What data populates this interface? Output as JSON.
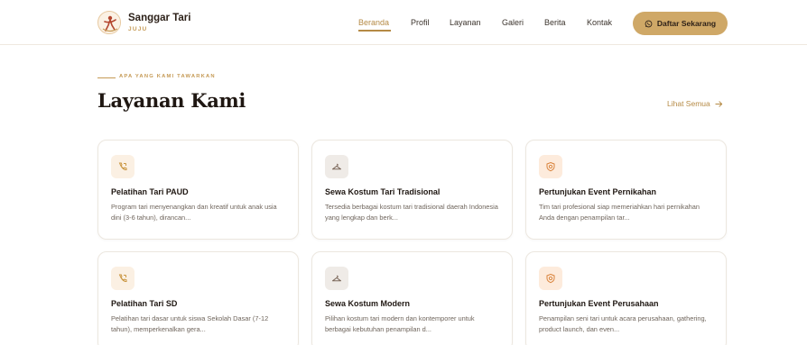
{
  "brand": {
    "name": "Sanggar Tari",
    "sub": "JUJU"
  },
  "nav": {
    "items": [
      {
        "label": "Beranda",
        "active": true
      },
      {
        "label": "Profil",
        "active": false
      },
      {
        "label": "Layanan",
        "active": false
      },
      {
        "label": "Galeri",
        "active": false
      },
      {
        "label": "Berita",
        "active": false
      },
      {
        "label": "Kontak",
        "active": false
      }
    ],
    "cta_label": "Daftar Sekarang",
    "cta_icon": "whatsapp-icon"
  },
  "section": {
    "eyebrow": "APA YANG KAMI TAWARKAN",
    "title": "Layanan Kami",
    "see_all": "Lihat Semua"
  },
  "cards": [
    {
      "icon": "phone-icon",
      "title": "Pelatihan Tari PAUD",
      "desc": "Program tari menyenangkan dan kreatif untuk anak usia dini (3-6 tahun), dirancan..."
    },
    {
      "icon": "hanger-icon",
      "title": "Sewa Kostum Tari Tradisional",
      "desc": "Tersedia berbagai kostum tari tradisional daerah Indonesia yang lengkap dan berk..."
    },
    {
      "icon": "shield-icon",
      "title": "Pertunjukan Event Pernikahan",
      "desc": "Tim tari profesional siap memeriahkan hari pernikahan Anda dengan penampilan tar..."
    },
    {
      "icon": "phone-icon",
      "title": "Pelatihan Tari SD",
      "desc": "Pelatihan tari dasar untuk siswa Sekolah Dasar (7-12 tahun), memperkenalkan gera..."
    },
    {
      "icon": "hanger-icon",
      "title": "Sewa Kostum Modern",
      "desc": "Pilihan kostum tari modern dan kontemporer untuk berbagai kebutuhan penampilan d..."
    },
    {
      "icon": "shield-icon",
      "title": "Pertunjukan Event Perusahaan",
      "desc": "Penampilan seni tari untuk acara perusahaan, gathering, product launch, dan even..."
    }
  ],
  "colors": {
    "accent": "#b58a45",
    "cta_bg": "#cfa867",
    "heading": "#1f1712"
  }
}
